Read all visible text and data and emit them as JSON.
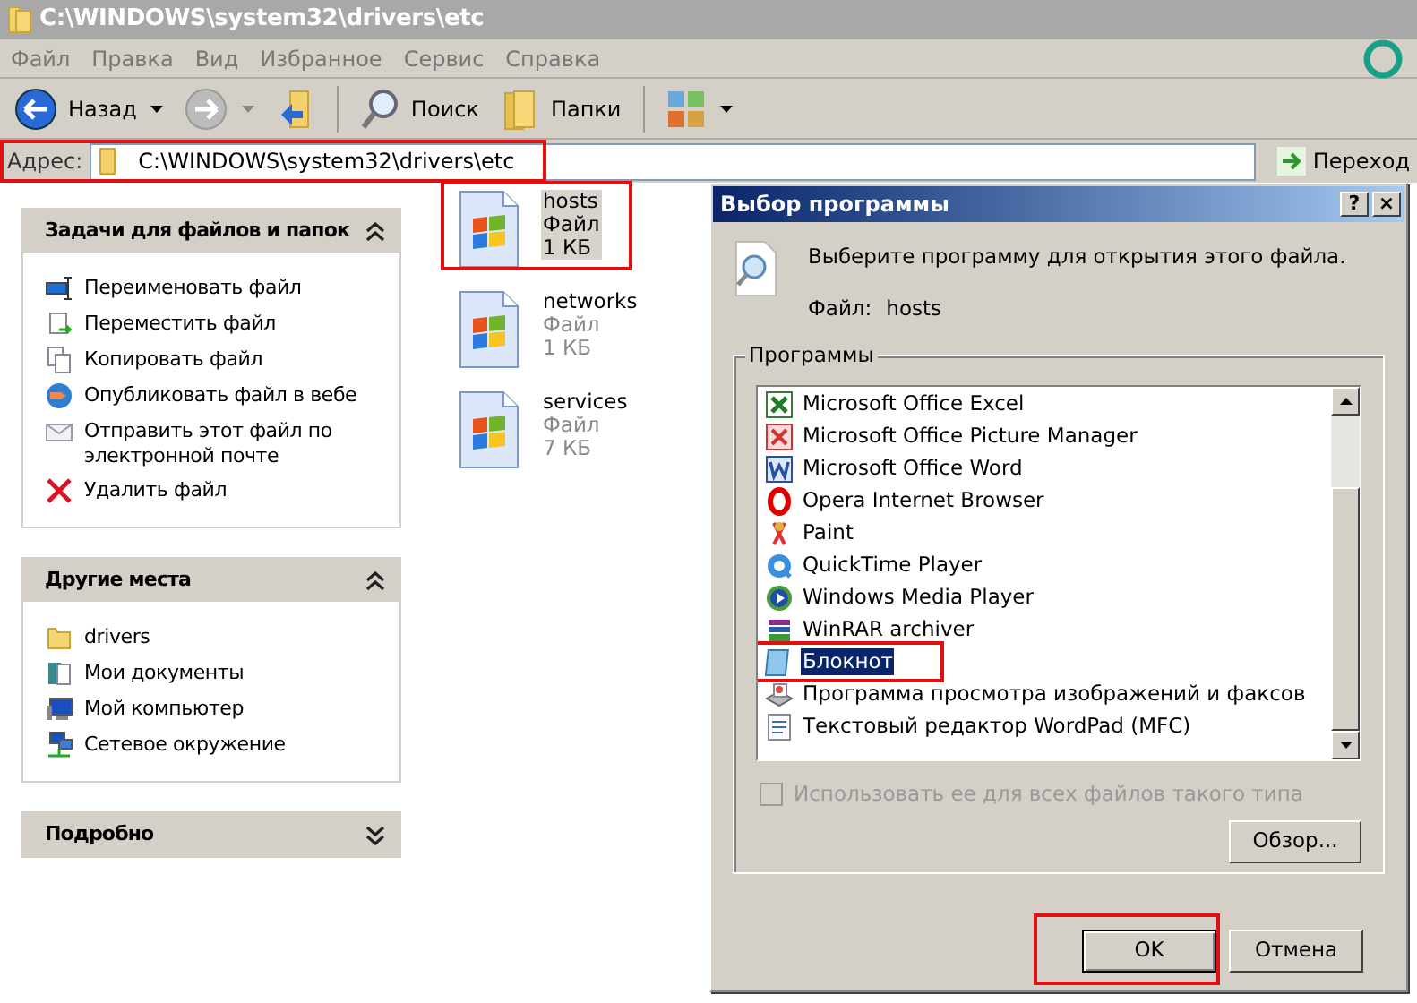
{
  "window": {
    "title": "C:\\WINDOWS\\system32\\drivers\\etc"
  },
  "menu": [
    "Файл",
    "Правка",
    "Вид",
    "Избранное",
    "Сервис",
    "Справка"
  ],
  "toolbar": [
    {
      "kind": "back",
      "label": "Назад"
    },
    {
      "kind": "forward"
    },
    {
      "kind": "up"
    },
    {
      "kind": "search",
      "label": "Поиск"
    },
    {
      "kind": "folders",
      "label": "Папки"
    },
    {
      "kind": "views"
    }
  ],
  "address_bar": {
    "label": "Адрес:",
    "value": "C:\\WINDOWS\\system32\\drivers\\etc",
    "go": "Переход",
    "highlighted": true
  },
  "sidebar": {
    "panels": [
      {
        "title": "Задачи для файлов и папок",
        "expanded": true,
        "items": [
          {
            "kind": "rename",
            "label": "Переименовать файл"
          },
          {
            "kind": "move",
            "label": "Переместить файл"
          },
          {
            "kind": "copy",
            "label": "Копировать файл"
          },
          {
            "kind": "publish",
            "label": "Опубликовать файл в вебе"
          },
          {
            "kind": "email",
            "label": "Отправить этот файл по электронной почте"
          },
          {
            "kind": "delete",
            "label": "Удалить файл"
          }
        ]
      },
      {
        "title": "Другие места",
        "expanded": true,
        "items": [
          {
            "kind": "folder",
            "label": "drivers"
          },
          {
            "kind": "documents",
            "label": "Мои документы"
          },
          {
            "kind": "computer",
            "label": "Мой компьютер"
          },
          {
            "kind": "network",
            "label": "Сетевое окружение"
          }
        ]
      },
      {
        "title": "Подробно",
        "expanded": false
      }
    ]
  },
  "files": [
    {
      "name": "hosts",
      "type": "Файл",
      "size": "1 КБ",
      "selected": true,
      "highlighted": true
    },
    {
      "name": "networks",
      "type": "Файл",
      "size": "1 КБ",
      "selected": false,
      "highlighted": false
    },
    {
      "name": "services",
      "type": "Файл",
      "size": "7 КБ",
      "selected": false,
      "highlighted": false
    }
  ],
  "dialog": {
    "title": "Выбор программы",
    "title_buttons": [
      "?",
      "×"
    ],
    "prompt": "Выберите программу для открытия этого файла.",
    "file_label": "Файл:",
    "file_name": "hosts",
    "group_label": "Программы",
    "programs": [
      {
        "kind": "excel",
        "name": "Microsoft Office Excel",
        "selected": false,
        "highlighted": false
      },
      {
        "kind": "picture",
        "name": "Microsoft Office Picture Manager",
        "selected": false,
        "highlighted": false
      },
      {
        "kind": "word",
        "name": "Microsoft Office Word",
        "selected": false,
        "highlighted": false
      },
      {
        "kind": "opera",
        "name": "Opera Internet Browser",
        "selected": false,
        "highlighted": false
      },
      {
        "kind": "paint",
        "name": "Paint",
        "selected": false,
        "highlighted": false
      },
      {
        "kind": "quicktime",
        "name": "QuickTime Player",
        "selected": false,
        "highlighted": false
      },
      {
        "kind": "mediaplayer",
        "name": "Windows Media Player",
        "selected": false,
        "highlighted": false
      },
      {
        "kind": "winrar",
        "name": "WinRAR archiver",
        "selected": false,
        "highlighted": false
      },
      {
        "kind": "notepad",
        "name": "Блокнот",
        "selected": true,
        "highlighted": true
      },
      {
        "kind": "faxviewer",
        "name": "Программа просмотра изображений и факсов",
        "selected": false,
        "highlighted": false
      },
      {
        "kind": "wordpad",
        "name": "Текстовый редактор WordPad (MFC)",
        "selected": false,
        "highlighted": false
      }
    ],
    "remember": {
      "label": "Использовать ее для всех файлов такого типа",
      "checked": false,
      "disabled": true
    },
    "browse_button": "Обзор...",
    "buttons": [
      {
        "label": "OK",
        "default": true,
        "highlighted": true
      },
      {
        "label": "Отмена",
        "default": false,
        "highlighted": false
      }
    ]
  }
}
